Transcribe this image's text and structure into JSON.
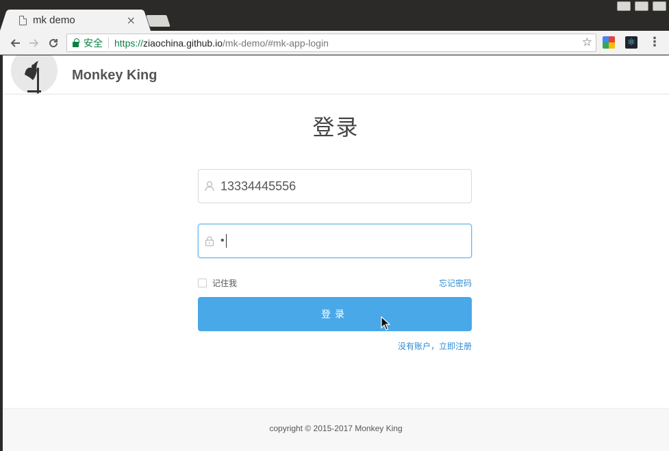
{
  "browser": {
    "tab_title": "mk demo",
    "tab_close": "×",
    "secure_label": "安全",
    "url_scheme": "https://",
    "url_host": "ziaochina.github.io",
    "url_path": "/mk-demo/#mk-app-login",
    "back_icon": "arrow-left-icon",
    "forward_icon": "arrow-right-icon",
    "reload_icon": "reload-icon"
  },
  "app": {
    "brand": "Monkey King"
  },
  "login": {
    "title": "登录",
    "username_value": "13334445556",
    "password_mask": "•",
    "remember_label": "记住我",
    "forgot_link": "忘记密码",
    "submit_label": "登录",
    "register_link": "没有账户，立即注册"
  },
  "footer": {
    "copyright": "copyright © 2015-2017 Monkey King"
  },
  "colors": {
    "primary": "#48a8e8",
    "link": "#2e8bd3",
    "secure_green": "#0b8043"
  }
}
